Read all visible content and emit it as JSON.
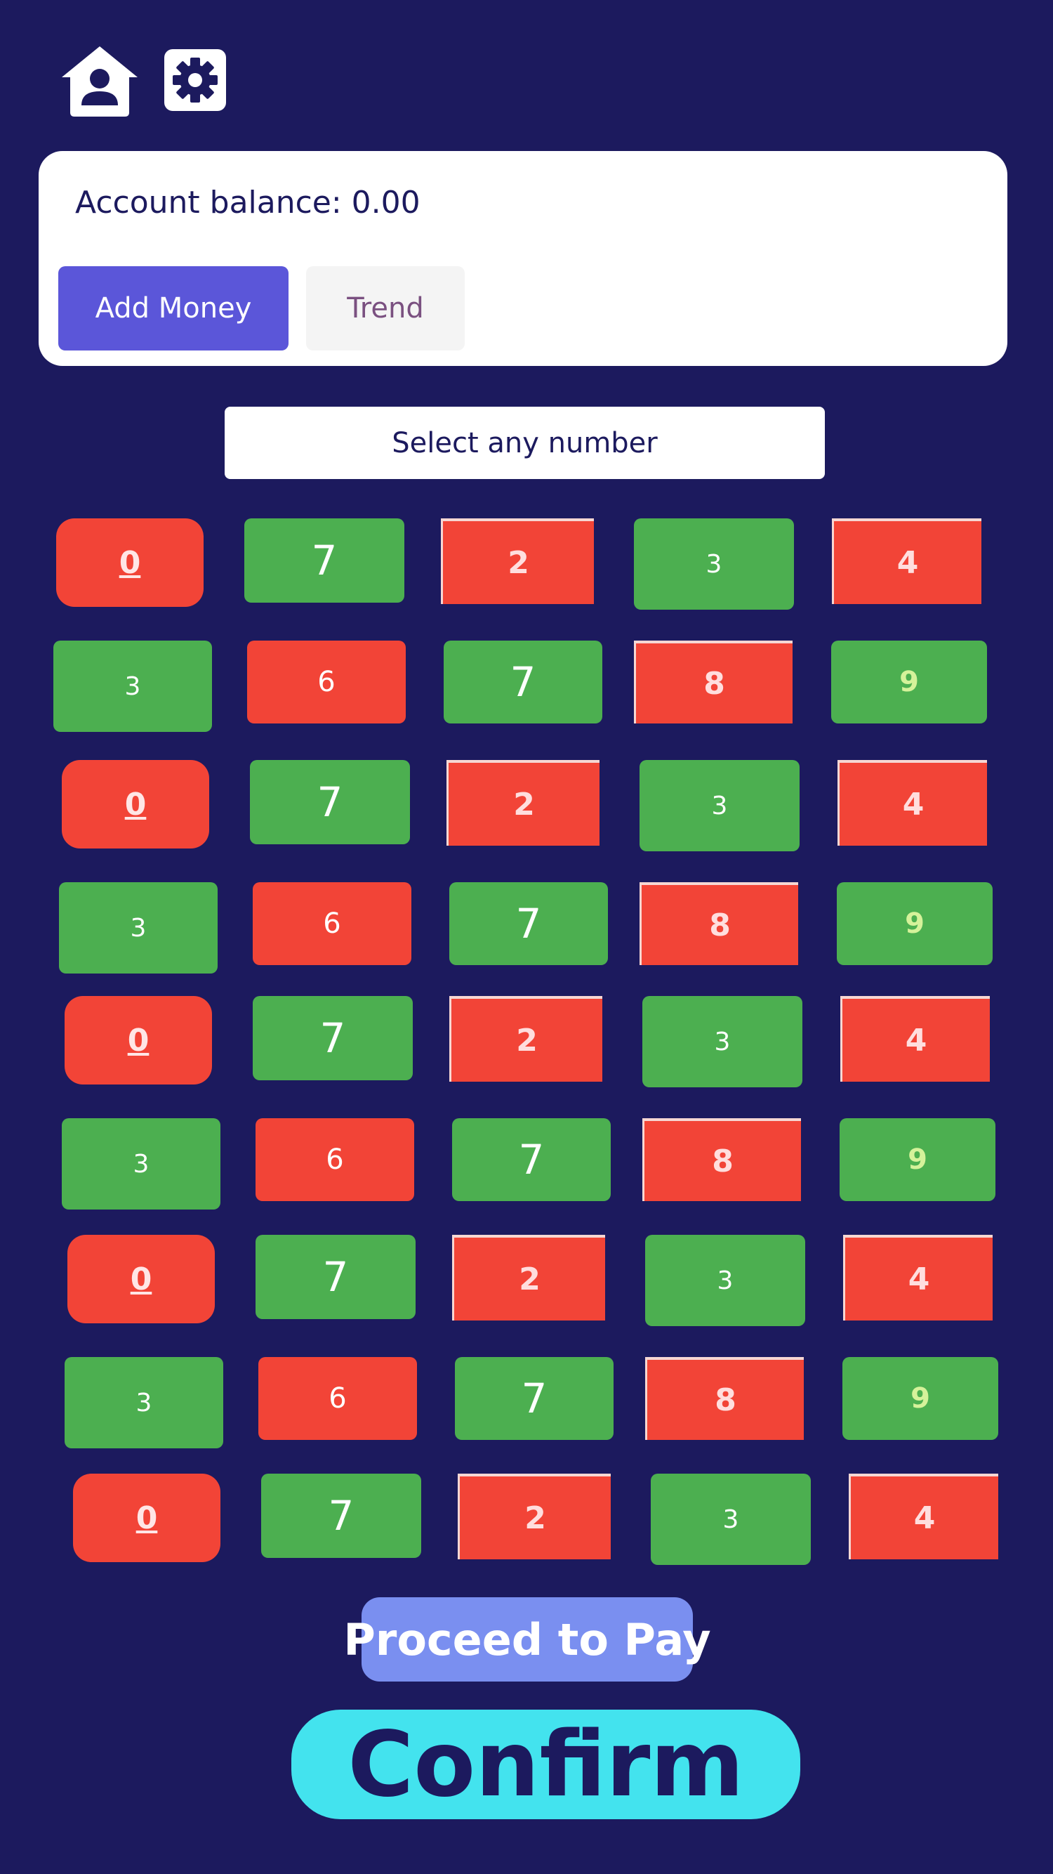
{
  "header": {
    "home_icon": "home-user-icon",
    "settings_icon": "gear-icon"
  },
  "account": {
    "balance_text": "Account balance: 0.00",
    "add_money_label": "Add Money",
    "trend_label": "Trend"
  },
  "selector": {
    "prompt": "Select any number"
  },
  "grid": {
    "rows": [
      [
        "0",
        "7",
        "2",
        "3",
        "4"
      ],
      [
        "3",
        "6",
        "7",
        "8",
        "9"
      ],
      [
        "0",
        "7",
        "2",
        "3",
        "4"
      ],
      [
        "3",
        "6",
        "7",
        "8",
        "9"
      ],
      [
        "0",
        "7",
        "2",
        "3",
        "4"
      ],
      [
        "3",
        "6",
        "7",
        "8",
        "9"
      ],
      [
        "0",
        "7",
        "2",
        "3",
        "4"
      ],
      [
        "3",
        "6",
        "7",
        "8",
        "9"
      ],
      [
        "0",
        "7",
        "2",
        "3",
        "4"
      ]
    ]
  },
  "actions": {
    "proceed_label": "Proceed to Pay",
    "confirm_label": "Confirm"
  },
  "colors": {
    "background": "#1c1a5e",
    "red": "#f24437",
    "green": "#4caf50",
    "add_money": "#5b56d9",
    "proceed": "#7a8ff0",
    "confirm": "#43e3ee"
  }
}
